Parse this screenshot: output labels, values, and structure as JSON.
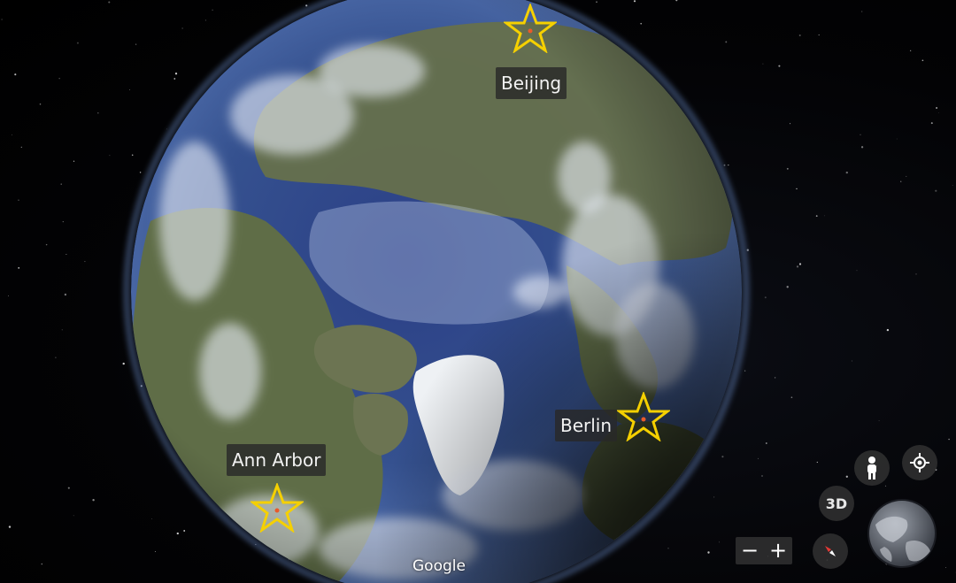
{
  "places": [
    {
      "name": "Beijing"
    },
    {
      "name": "Berlin"
    },
    {
      "name": "Ann Arbor"
    }
  ],
  "controls": {
    "view_3d_label": "3D",
    "zoom_out_label": "−",
    "zoom_in_label": "+",
    "icons": [
      "pegman-icon",
      "my-location-icon",
      "compass-icon",
      "star-icon",
      "mini-globe-icon"
    ]
  },
  "branding": {
    "logo_text": "Google"
  },
  "colors": {
    "star_outline": "#f5d000",
    "label_background": "#282828",
    "ocean": "#2f4a8a",
    "ice": "#eef1f4",
    "land": "#5c6f48"
  }
}
